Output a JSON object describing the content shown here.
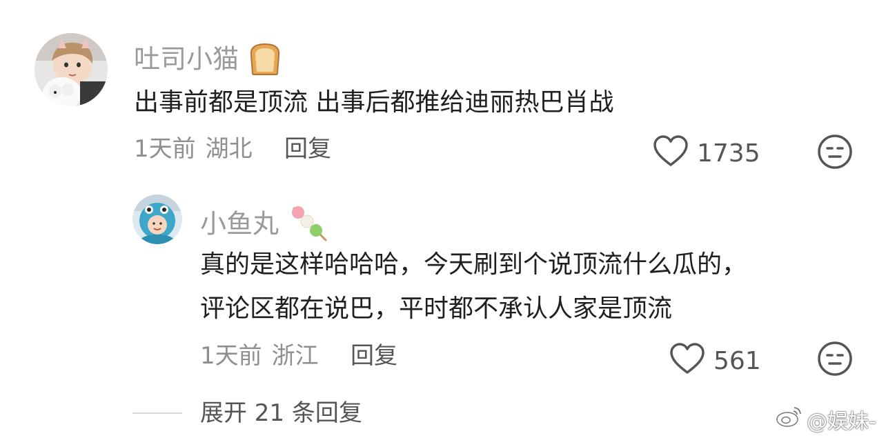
{
  "comment": {
    "username": "吐司小猫",
    "text": "出事前都是顶流 出事后都推给迪丽热巴肖战",
    "time": "1天前",
    "location": "湖北",
    "reply_label": "回复",
    "likes": "1735"
  },
  "reply": {
    "username": "小鱼丸",
    "text_line1": "真的是这样哈哈哈，今天刷到个说顶流什么瓜的，",
    "text_line2": "评论区都在说巴，平时都不承认人家是顶流",
    "time": "1天前",
    "location": "浙江",
    "reply_label": "回复",
    "likes": "561"
  },
  "expand_label": "展开 21 条回复",
  "watermark": "@娱妹-",
  "colors": {
    "username": "#9a9a9a",
    "text": "#1f1f1f",
    "meta": "#8f8f8f",
    "icon": "#555555"
  }
}
